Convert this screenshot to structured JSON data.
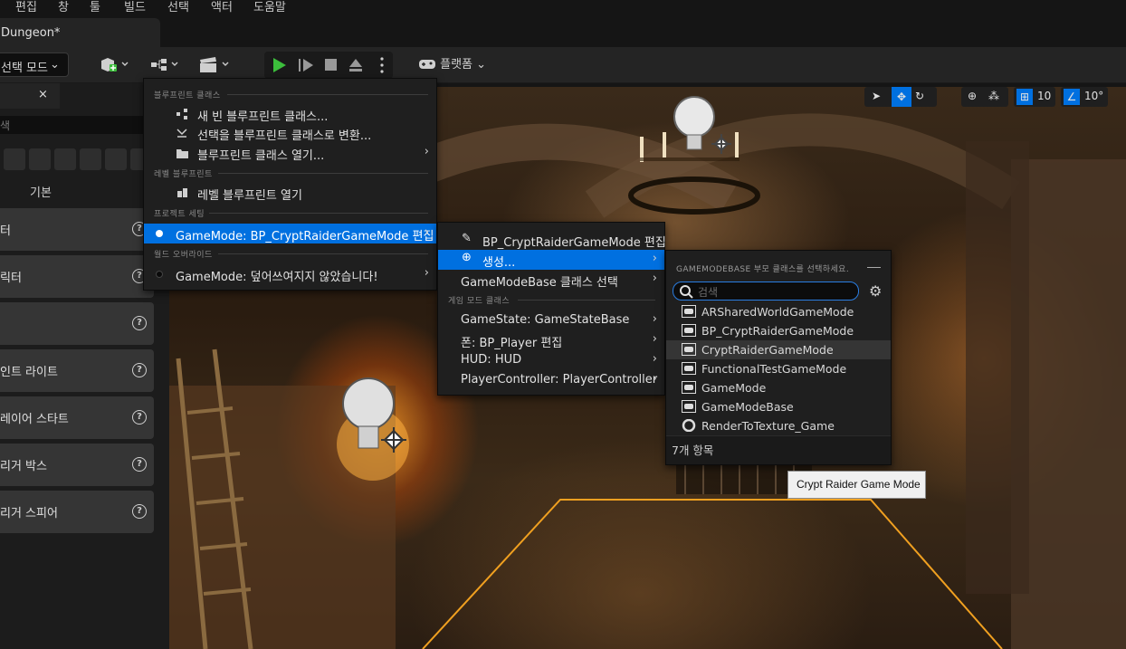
{
  "menubar": [
    "편집",
    "창",
    "툴",
    "빌드",
    "선택",
    "액터",
    "도움말"
  ],
  "document_tab": "Dungeon*",
  "toolbar": {
    "mode_label": "선택 모드",
    "platform_label": "플랫폼"
  },
  "left_panel": {
    "close_label": "×",
    "search_placeholder": "색",
    "basic_label": "기본",
    "items": [
      "터",
      "릭터",
      "",
      "인트 라이트",
      "레이어 스타트",
      "리거 박스",
      "리거 스피어"
    ]
  },
  "viewport": {
    "grid_value": "10",
    "angle_value": "10°"
  },
  "menu_blueprint": {
    "sections": {
      "blueprint_class": "블루프린트 클래스",
      "level_blueprint": "레벨 블루프린트",
      "project_settings": "프로젝트 세팅",
      "world_override": "월드 오버라이드"
    },
    "items": {
      "new_blueprint": "새 빈 블루프린트 클래스...",
      "convert_selection": "선택을 블루프린트 클래스로 변환...",
      "open_blueprint": "블루프린트 클래스 열기...",
      "open_level_blueprint": "레벨 블루프린트 열기",
      "gamemode_edit": "GameMode: BP_CryptRaiderGameMode 편집",
      "gamemode_override": "GameMode: 덮어쓰여지지 않았습니다!"
    }
  },
  "menu_gamemode": {
    "edit": "BP_CryptRaiderGameMode 편집",
    "create": "생성...",
    "select_base": "GameModeBase 클래스 선택",
    "section_game_mode_classes": "게임 모드 클래스",
    "gamestate": "GameState: GameStateBase",
    "pawn": "폰: BP_Player 편집",
    "hud": "HUD: HUD",
    "player_controller": "PlayerController: PlayerController"
  },
  "menu_parent_class": {
    "header": "GAMEMODEBASE 부모 클래스를 선택하세요.",
    "search_placeholder": "검색",
    "classes": [
      "ARSharedWorldGameMode",
      "BP_CryptRaiderGameMode",
      "CryptRaiderGameMode",
      "FunctionalTestGameMode",
      "GameMode",
      "GameModeBase",
      "RenderToTexture_Game"
    ],
    "count": "7개 항목"
  },
  "tooltip": "Crypt Raider Game Mode",
  "colors": {
    "accent": "#0070e0",
    "play_green": "#3cbe3c",
    "panel": "#1f1f1f"
  }
}
